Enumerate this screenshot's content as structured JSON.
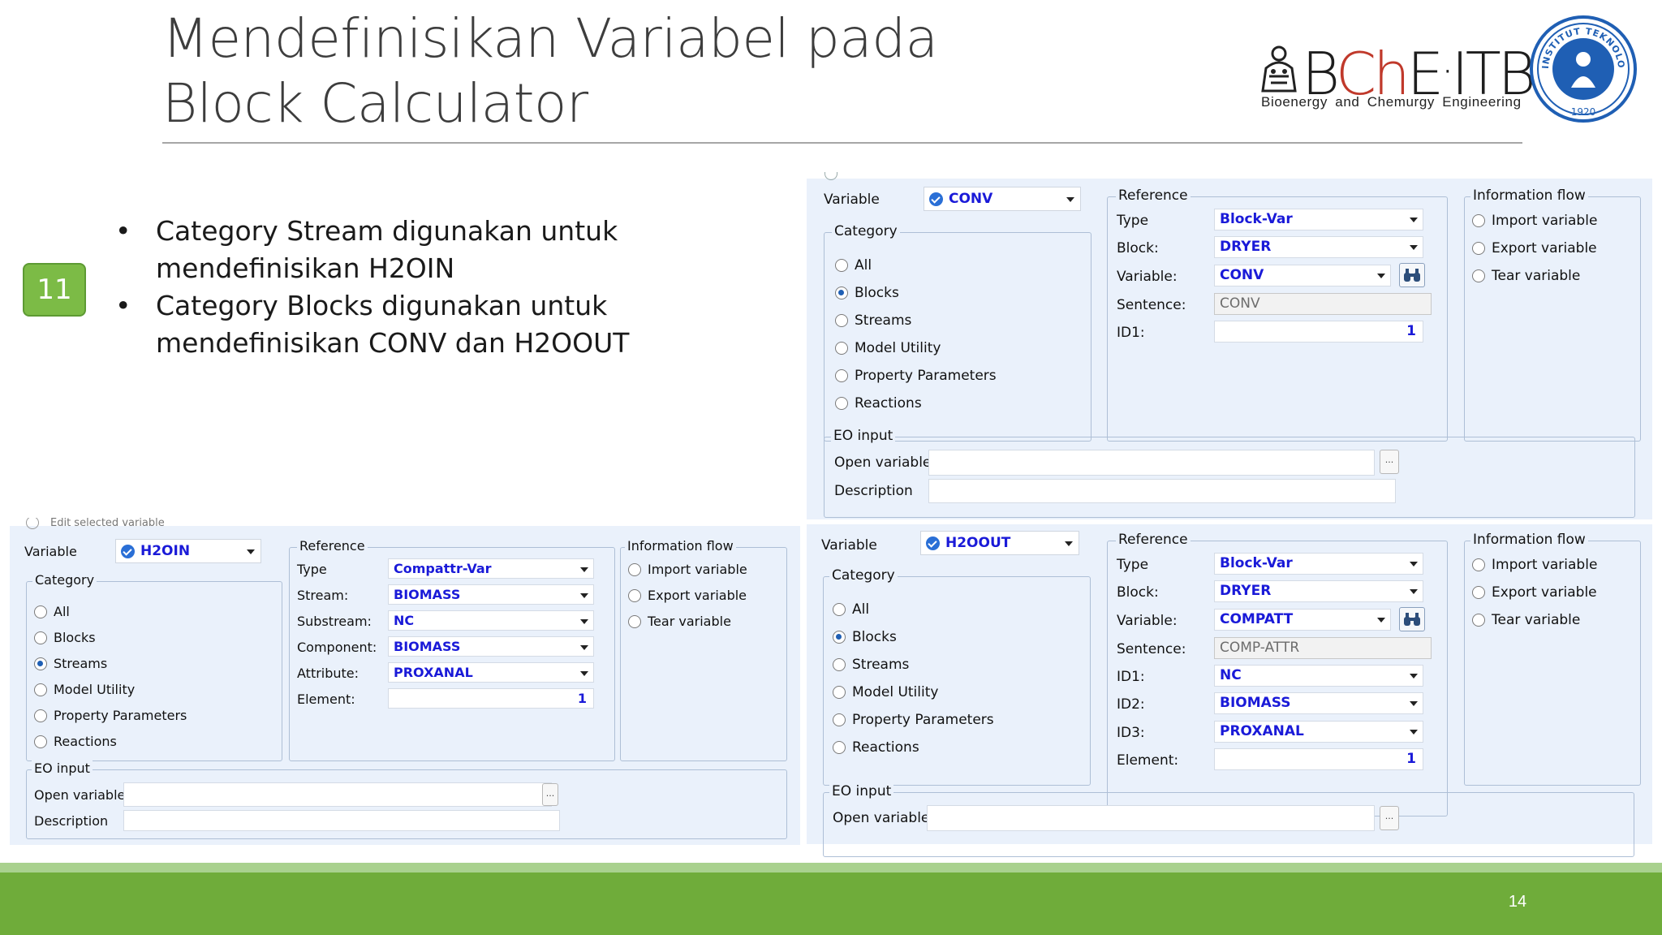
{
  "slide": {
    "title": "Mendefinisikan Variabel pada Block Calculator",
    "badge": "11",
    "bullets": [
      "Category Stream digunakan untuk mendefinisikan H2OIN",
      "Category Blocks digunakan untuk mendefinisikan CONV dan H2OOUT"
    ],
    "page_number": "14",
    "logo": {
      "brand_b": "B",
      "brand_ch": "Ch",
      "brand_e": "E",
      "brand_dot": "·",
      "brand_itb": "ITB",
      "subtitle": "Bioenergy and Chemurgy Engineering"
    },
    "seal_text": "INSTITUT TEKNOLOGI BANDUNG",
    "seal_year": "1920"
  },
  "colors": {
    "accent_green": "#6fac3a",
    "light_green": "#a9d18e",
    "badge_green": "#7cbb46",
    "value_blue": "#1a1ad8",
    "panel_bg": "#eaf1fb",
    "logo_red": "#c0392b",
    "seal_blue": "#1f5fb4"
  },
  "labels": {
    "variable": "Variable",
    "category": "Category",
    "reference": "Reference",
    "info_flow": "Information flow",
    "eo_input": "EO input",
    "open_variable": "Open variable",
    "description": "Description",
    "all": "All",
    "blocks": "Blocks",
    "streams": "Streams",
    "model_utility": "Model Utility",
    "property_parameters": "Property Parameters",
    "reactions": "Reactions",
    "import_variable": "Import variable",
    "export_variable": "Export variable",
    "tear_variable": "Tear variable",
    "type": "Type",
    "block": "Block:",
    "variable_colon": "Variable:",
    "sentence": "Sentence:",
    "id1": "ID1:",
    "id2": "ID2:",
    "id3": "ID3:",
    "element": "Element:",
    "stream": "Stream:",
    "substream": "Substream:",
    "component": "Component:",
    "attribute": "Attribute:",
    "ellipsis": "...",
    "cut_text": "Edit selected variable"
  },
  "panel_conv": {
    "variable_name": "CONV",
    "selected_category": "Blocks",
    "type": "Block-Var",
    "block": "DRYER",
    "variable": "CONV",
    "sentence": "CONV",
    "id1": "1"
  },
  "panel_h2oin": {
    "variable_name": "H2OIN",
    "selected_category": "Streams",
    "type": "Compattr-Var",
    "stream": "BIOMASS",
    "substream": "NC",
    "component": "BIOMASS",
    "attribute": "PROXANAL",
    "element": "1"
  },
  "panel_h2oout": {
    "variable_name": "H2OOUT",
    "selected_category": "Blocks",
    "type": "Block-Var",
    "block": "DRYER",
    "variable": "COMPATT",
    "sentence": "COMP-ATTR",
    "id1": "NC",
    "id2": "BIOMASS",
    "id3": "PROXANAL",
    "element": "1"
  }
}
